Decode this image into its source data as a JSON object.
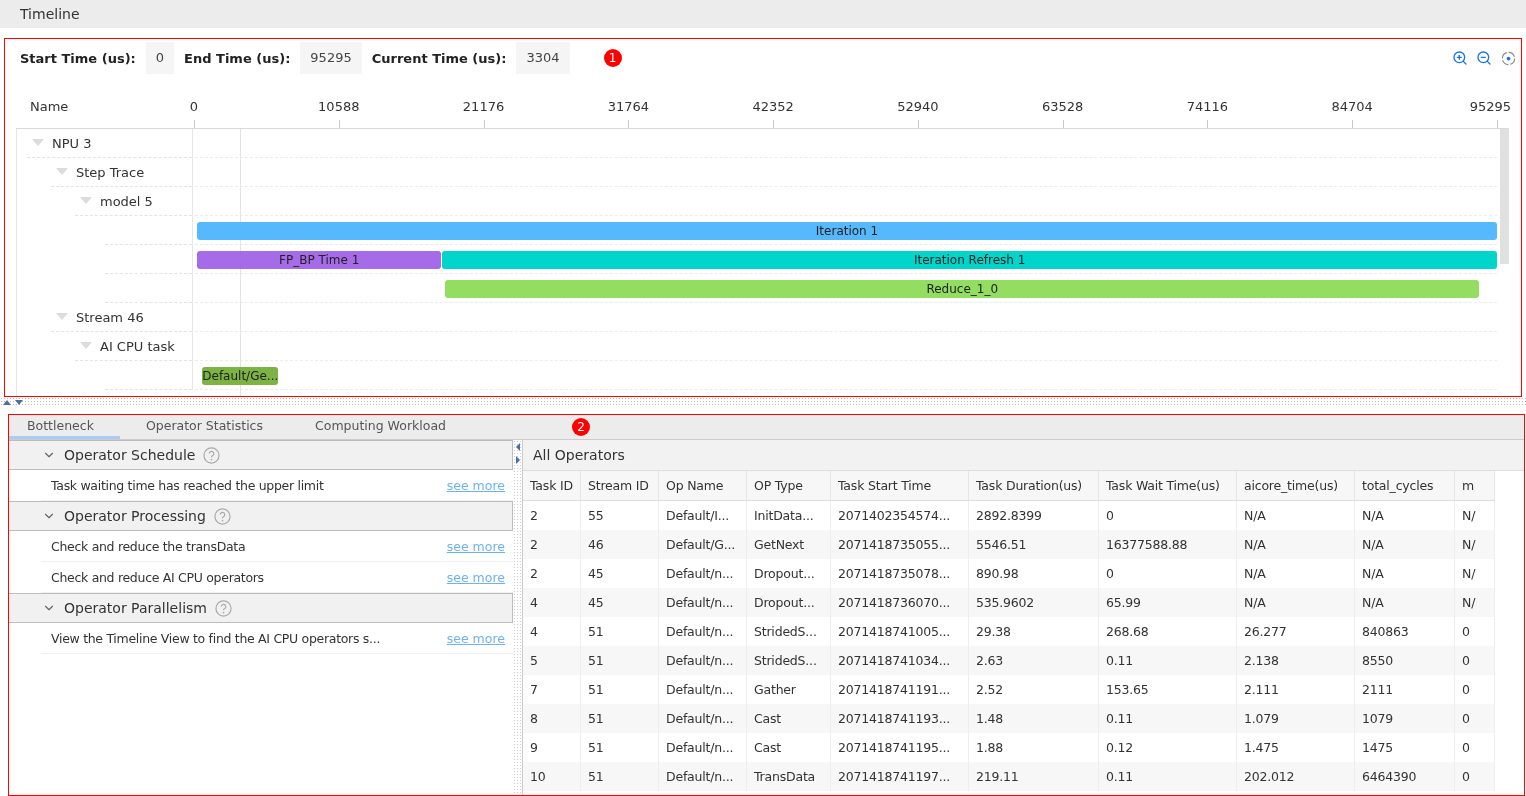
{
  "window": {
    "title": "Timeline"
  },
  "timeline": {
    "fields": [
      {
        "label": "Start Time (us):",
        "value": "0"
      },
      {
        "label": "End Time (us):",
        "value": "95295"
      },
      {
        "label": "Current Time (us):",
        "value": "3304"
      }
    ],
    "callout": "1",
    "name_header": "Name",
    "ticks": [
      "0",
      "10588",
      "21176",
      "31764",
      "42352",
      "52940",
      "63528",
      "74116",
      "84704",
      "95295"
    ],
    "tree": [
      {
        "label": "NPU 3",
        "expanded": true,
        "children": [
          {
            "label": "Step Trace",
            "expanded": true,
            "children": [
              {
                "label": "model 5",
                "expanded": true,
                "lanes": [
                  [
                    {
                      "label": "Iteration 1",
                      "color": "#56b9fd"
                    }
                  ],
                  [
                    {
                      "label": "FP_BP Time 1",
                      "color": "#a66be8"
                    },
                    {
                      "label": "Iteration Refresh 1",
                      "color": "#00d5cc"
                    }
                  ],
                  [
                    {
                      "label": "Reduce_1_0",
                      "color": "#93dd60"
                    }
                  ]
                ]
              }
            ]
          },
          {
            "label": "Stream 46",
            "expanded": true,
            "children": [
              {
                "label": "AI CPU task",
                "expanded": true,
                "lanes": [
                  [
                    {
                      "label": "Default/Ge...",
                      "color": "#7cb342"
                    }
                  ]
                ]
              }
            ]
          }
        ]
      }
    ]
  },
  "bottom": {
    "callout": "2",
    "tabs": [
      {
        "label": "Bottleneck",
        "selected": true
      },
      {
        "label": "Operator Statistics",
        "selected": false
      },
      {
        "label": "Computing Workload",
        "selected": false
      }
    ],
    "sections": [
      {
        "title": "Operator Schedule",
        "expanded": true,
        "items": [
          {
            "text": "Task waiting time has reached the upper limit",
            "link": "see more"
          }
        ]
      },
      {
        "title": "Operator Processing",
        "expanded": true,
        "items": [
          {
            "text": "Check and reduce the transData",
            "link": "see more"
          },
          {
            "text": "Check and reduce AI CPU operators",
            "link": "see more"
          }
        ]
      },
      {
        "title": "Operator Parallelism",
        "expanded": true,
        "items": [
          {
            "text": "View the Timeline View to find the AI CPU operators s...",
            "link": "see more"
          }
        ]
      }
    ],
    "table": {
      "title": "All Operators",
      "columns": [
        "Task ID",
        "Stream ID",
        "Op Name",
        "OP Type",
        "Task Start Time",
        "Task Duration(us)",
        "Task Wait Time(us)",
        "aicore_time(us)",
        "total_cycles",
        "m"
      ],
      "rows": [
        [
          "2",
          "55",
          "Default/I...",
          "InitData...",
          "2071402354574...",
          "2892.8399",
          "0",
          "N/A",
          "N/A",
          "N/"
        ],
        [
          "2",
          "46",
          "Default/G...",
          "GetNext",
          "2071418735055...",
          "5546.51",
          "16377588.88",
          "N/A",
          "N/A",
          "N/"
        ],
        [
          "2",
          "45",
          "Default/n...",
          "Dropout...",
          "2071418735078...",
          "890.98",
          "0",
          "N/A",
          "N/A",
          "N/"
        ],
        [
          "4",
          "45",
          "Default/n...",
          "Dropout...",
          "2071418736070...",
          "535.9602",
          "65.99",
          "N/A",
          "N/A",
          "N/"
        ],
        [
          "4",
          "51",
          "Default/n...",
          "StridedS...",
          "2071418741005...",
          "29.38",
          "268.68",
          "26.277",
          "840863",
          "0"
        ],
        [
          "5",
          "51",
          "Default/n...",
          "StridedS...",
          "2071418741034...",
          "2.63",
          "0.11",
          "2.138",
          "8550",
          "0"
        ],
        [
          "7",
          "51",
          "Default/n...",
          "Gather",
          "2071418741191...",
          "2.52",
          "153.65",
          "2.111",
          "2111",
          "0"
        ],
        [
          "8",
          "51",
          "Default/n...",
          "Cast",
          "2071418741193...",
          "1.48",
          "0.11",
          "1.079",
          "1079",
          "0"
        ],
        [
          "9",
          "51",
          "Default/n...",
          "Cast",
          "2071418741195...",
          "1.88",
          "0.12",
          "1.475",
          "1475",
          "0"
        ],
        [
          "10",
          "51",
          "Default/n...",
          "TransData",
          "2071418741197...",
          "219.11",
          "0.11",
          "202.012",
          "6464390",
          "0"
        ]
      ]
    }
  }
}
